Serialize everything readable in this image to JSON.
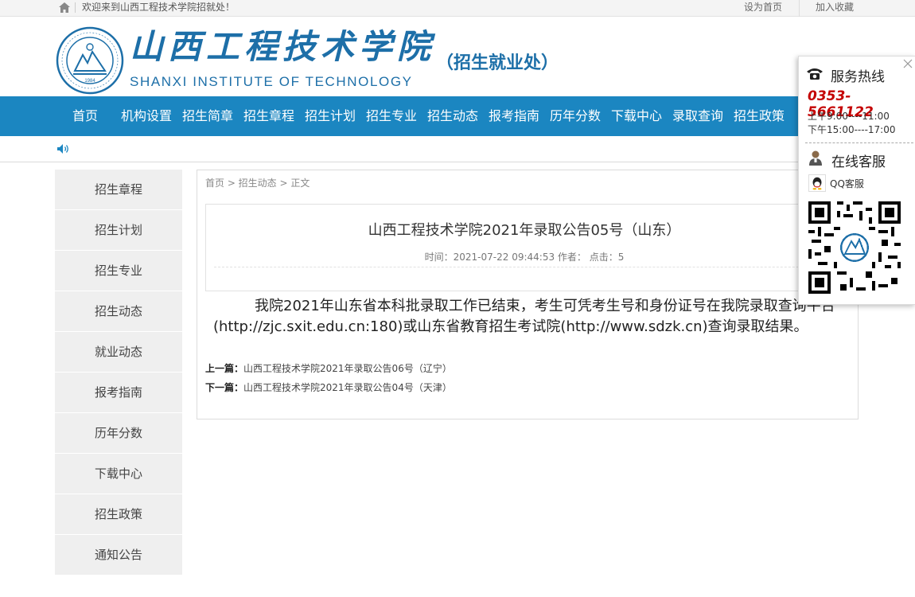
{
  "topbar": {
    "welcome": "欢迎来到山西工程技术学院招就处！",
    "set_home": "设为首页",
    "add_fav": "加入收藏"
  },
  "header": {
    "logo_cn": "山西工程技术学院",
    "logo_en": "SHANXI INSTITUTE OF TECHNOLOGY",
    "dept": "（招生就业处）",
    "seal_year": "1984"
  },
  "nav": {
    "items": [
      "首页",
      "机构设置",
      "招生简章",
      "招生章程",
      "招生计划",
      "招生专业",
      "招生动态",
      "报考指南",
      "历年分数",
      "下载中心",
      "录取查询",
      "招生政策"
    ]
  },
  "sidebar": {
    "items": [
      "招生章程",
      "招生计划",
      "招生专业",
      "招生动态",
      "就业动态",
      "报考指南",
      "历年分数",
      "下载中心",
      "招生政策",
      "通知公告"
    ]
  },
  "article": {
    "breadcrumb": "首页 > 招生动态 > 正文",
    "title": "山西工程技术学院2021年录取公告05号（山东）",
    "meta": "时间：2021-07-22 09:44:53 作者：  点击：5",
    "body": "我院2021年山东省本科批录取工作已结束，考生可凭考生号和身份证号在我院录取查询平台(http://zjc.sxit.edu.cn:180)或山东省教育招生考试院(http://www.sdzk.cn)查询录取结果。",
    "prev_label": "上一篇：",
    "prev_title": "山西工程技术学院2021年录取公告06号（辽宁）",
    "next_label": "下一篇：",
    "next_title": "山西工程技术学院2021年录取公告04号（天津）"
  },
  "float_panel": {
    "hotline_label": "服务热线",
    "phone": "0353-5661122",
    "hours_am": "上午9:00----11:00",
    "hours_pm": "下午15:00----17:00",
    "cs_label": "在线客服",
    "qq_label": "QQ客服"
  },
  "colors": {
    "nav_bg": "#1b86c1",
    "brand_blue": "#1d6fa8",
    "phone_red": "#c40000"
  }
}
